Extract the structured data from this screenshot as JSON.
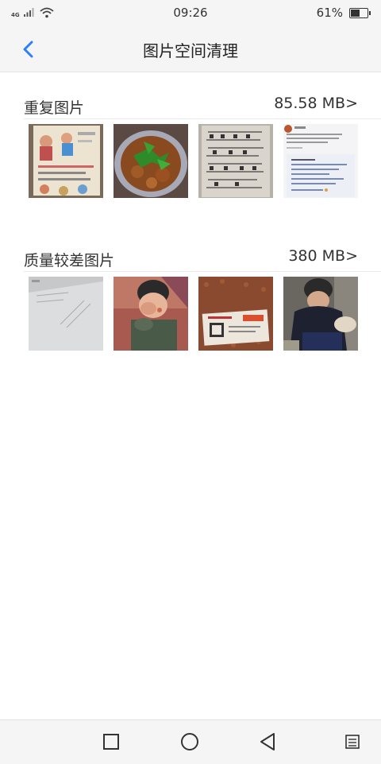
{
  "status_bar": {
    "network": "4G",
    "time": "09:26",
    "battery_percent": "61%",
    "battery_level": 0.61
  },
  "header": {
    "back_icon": "chevron-left-icon",
    "title": "图片空间清理",
    "accent_color": "#2d7ff9"
  },
  "sections": [
    {
      "title": "重复图片",
      "size": "85.58 MB>",
      "thumbnails": [
        "photo-worksheet-book",
        "photo-food-cilantro",
        "photo-handwritten-page",
        "photo-chat-screenshot"
      ]
    },
    {
      "title": "质量较差图片",
      "size": "380 MB>",
      "thumbnails": [
        "photo-document-paper",
        "photo-child-covering-face",
        "photo-package-label",
        "photo-child-sitting"
      ]
    }
  ],
  "nav_bar": {
    "recent_icon": "square-icon",
    "home_icon": "circle-icon",
    "back_icon": "triangle-back-icon",
    "menu_icon": "menu-icon"
  }
}
